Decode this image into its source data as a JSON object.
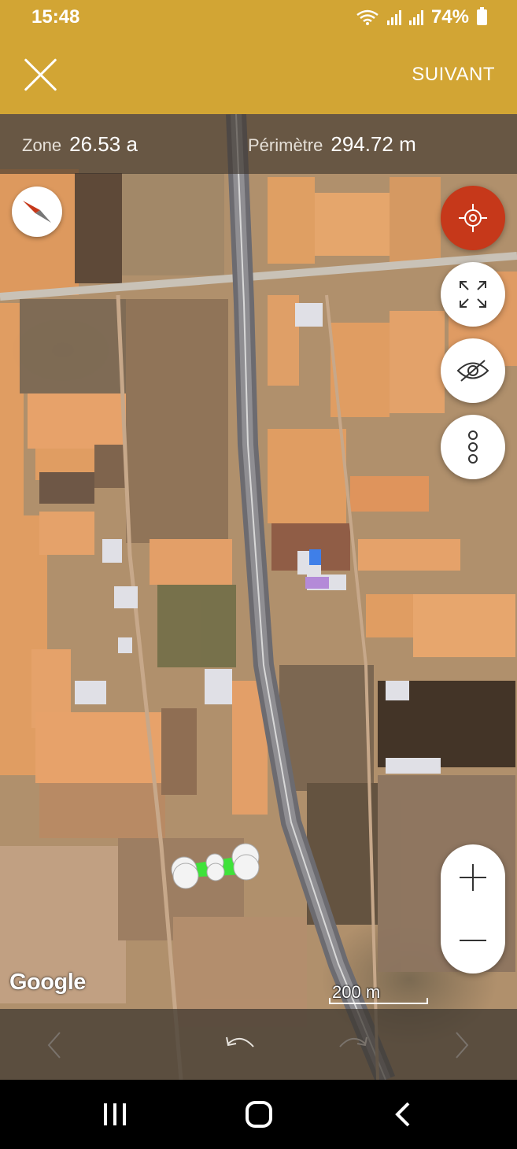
{
  "status_bar": {
    "time": "15:48",
    "battery": "74%",
    "icons": [
      "wifi-icon",
      "signal-icon",
      "signal-icon",
      "battery-icon"
    ]
  },
  "toolbar": {
    "close_icon": "close-icon",
    "next_label": "SUIVANT"
  },
  "measurement": {
    "area_label": "Zone",
    "area_value": "26.53 a",
    "perimeter_label": "Périmètre",
    "perimeter_value": "294.72 m"
  },
  "map": {
    "attribution": "Google",
    "scale_label": "200 m",
    "accent_color": "#c6381a",
    "polygon_color": "#3fe23a",
    "controls": [
      "compass-icon",
      "my-location-icon",
      "fullscreen-icon",
      "visibility-off-icon",
      "more-vertical-icon",
      "zoom-in-icon",
      "zoom-out-icon"
    ]
  },
  "edit_bar": {
    "icons": [
      "previous-icon",
      "undo-icon",
      "redo-icon",
      "next-icon"
    ]
  },
  "nav_bar": {
    "icons": [
      "recents-icon",
      "home-icon",
      "back-icon"
    ]
  },
  "colors": {
    "app_bar": "#d2a534",
    "locate_button": "#c6381a"
  }
}
